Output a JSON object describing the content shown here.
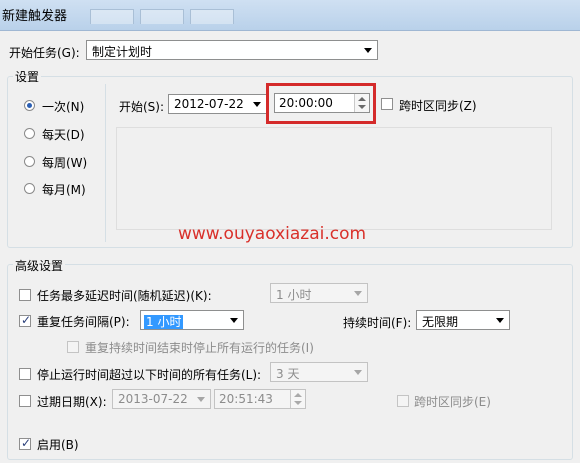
{
  "window": {
    "title": "新建触发器"
  },
  "begin_task": {
    "label": "开始任务(G):",
    "value": "制定计划时"
  },
  "settings": {
    "group_label": "设置",
    "schedule_options": [
      {
        "label": "一次(N)",
        "selected": true
      },
      {
        "label": "每天(D)",
        "selected": false
      },
      {
        "label": "每周(W)",
        "selected": false
      },
      {
        "label": "每月(M)",
        "selected": false
      }
    ],
    "start_label": "开始(S):",
    "start_date": "2012-07-22",
    "start_time": "20:00:00",
    "sync_timezone_label": "跨时区同步(Z)"
  },
  "watermark": "www.ouyaoxiazai.com",
  "advanced": {
    "group_label": "高级设置",
    "delay_task": {
      "label": "任务最多延迟时间(随机延迟)(K):",
      "value": "1 小时",
      "checked": false
    },
    "repeat_task": {
      "label": "重复任务间隔(P):",
      "value": "1 小时",
      "checked": true
    },
    "duration": {
      "label": "持续时间(F):",
      "value": "无限期"
    },
    "stop_all_at_end": {
      "label": "重复持续时间结束时停止所有运行的任务(I)",
      "checked": false
    },
    "stop_if_longer": {
      "label": "停止运行时间超过以下时间的所有任务(L):",
      "value": "3 天",
      "checked": false
    },
    "expire": {
      "label": "过期日期(X):",
      "date": "2013-07-22",
      "time": "20:51:43",
      "checked": false
    },
    "expire_sync_label": "跨时区同步(E)",
    "enabled": {
      "label": "启用(B)",
      "checked": true
    }
  },
  "colors": {
    "highlight": "#d42a2a",
    "watermark": "#d9302a",
    "selection": "#3399ff"
  }
}
